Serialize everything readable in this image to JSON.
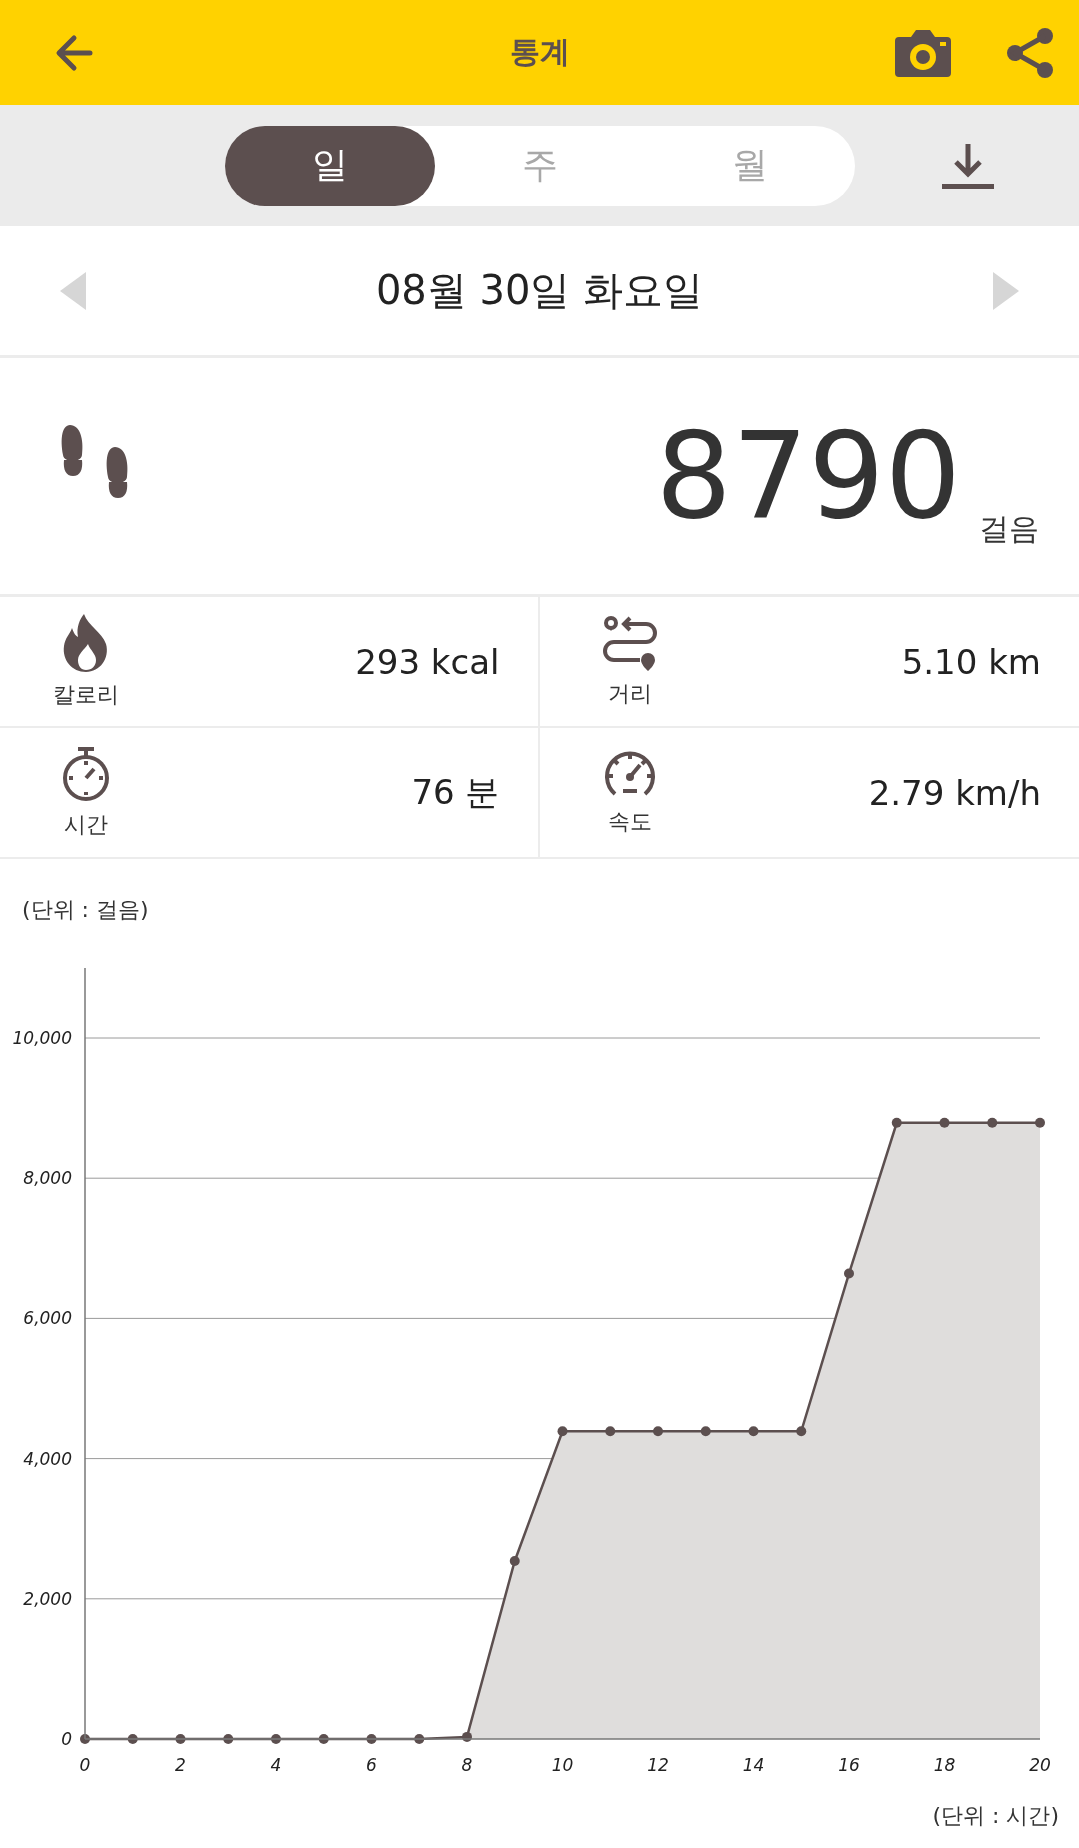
{
  "header": {
    "title": "통계"
  },
  "period_tabs": [
    {
      "label": "일",
      "selected": true
    },
    {
      "label": "주",
      "selected": false
    },
    {
      "label": "월",
      "selected": false
    }
  ],
  "date": "08월 30일 화요일",
  "steps": {
    "value": "8790",
    "unit": "걸음"
  },
  "stats": [
    {
      "kind": "calories",
      "label": "칼로리",
      "value": "293 kcal"
    },
    {
      "kind": "distance",
      "label": "거리",
      "value": "5.10 km"
    },
    {
      "kind": "time",
      "label": "시간",
      "value": "76 분"
    },
    {
      "kind": "speed",
      "label": "속도",
      "value": "2.79 km/h"
    }
  ],
  "chart": {
    "y_unit": "(단위 : 걸음)",
    "x_unit": "(단위 : 시간)",
    "chart_data": {
      "type": "area",
      "x": [
        0,
        1,
        2,
        3,
        4,
        5,
        6,
        7,
        8,
        9,
        10,
        11,
        12,
        13,
        14,
        15,
        16,
        17,
        18,
        19,
        20
      ],
      "grid": true,
      "series": [
        {
          "color": "#5c4f4f",
          "values": [
            0,
            0,
            0,
            0,
            0,
            0,
            0,
            0,
            30,
            2540,
            4390,
            4390,
            4390,
            4390,
            4390,
            4390,
            6640,
            8790,
            8790,
            8790,
            8790
          ]
        }
      ],
      "xlim": [
        0,
        20
      ],
      "ylim": [
        0,
        11000
      ],
      "xticks": [
        {
          "value": 0,
          "label": "0"
        },
        {
          "value": 2,
          "label": "2"
        },
        {
          "value": 4,
          "label": "4"
        },
        {
          "value": 6,
          "label": "6"
        },
        {
          "value": 8,
          "label": "8"
        },
        {
          "value": 10,
          "label": "10"
        },
        {
          "value": 12,
          "label": "12"
        },
        {
          "value": 14,
          "label": "14"
        },
        {
          "value": 16,
          "label": "16"
        },
        {
          "value": 18,
          "label": "18"
        },
        {
          "value": 20,
          "label": "20"
        }
      ],
      "yticks": [
        {
          "value": 0,
          "label": "0"
        },
        {
          "value": 2000,
          "label": "2,000"
        },
        {
          "value": 4000,
          "label": "4,000"
        },
        {
          "value": 6000,
          "label": "6,000"
        },
        {
          "value": 8000,
          "label": "8,000"
        },
        {
          "value": 10000,
          "label": "10,000"
        }
      ]
    }
  }
}
